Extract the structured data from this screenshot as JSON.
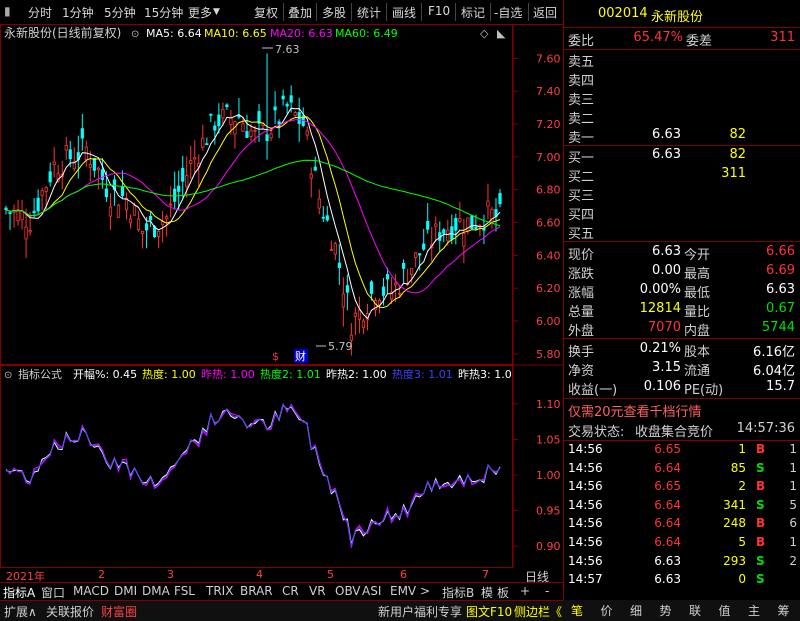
{
  "toolbar": {
    "left_items": [
      "分时",
      "1分钟",
      "5分钟",
      "15分钟",
      "更多"
    ],
    "right_items": [
      "复权",
      "叠加",
      "多股",
      "统计",
      "画线",
      "F10",
      "标记",
      "-自选",
      "返回"
    ]
  },
  "main_chart": {
    "stock_label": "永新股份(日线前复权)",
    "ma5": "MA5: 6.64",
    "ma10": "MA10: 6.65",
    "ma20": "MA20: 6.63",
    "ma60": "MA60: 6.49",
    "high_mark": "7.63",
    "low_mark": "5.79",
    "marker_s": "$",
    "marker_cai": "财"
  },
  "indicator": {
    "name": "指标公式",
    "kaifu": "开幅%: 0.45",
    "redu": "热度: 1.00",
    "zuore": "昨热: 1.00",
    "redu2": "热度2: 1.01",
    "zuore2": "昨热2: 1.00",
    "redu3": "热度3: 1.01",
    "zuore3": "昨热3: 1.0"
  },
  "colors": {
    "ma5": "#ffffff",
    "ma10": "#ffff00",
    "ma20": "#ff00ff",
    "ma60": "#00ff00",
    "up": "#ff3333",
    "down": "#00ffff",
    "frame": "#800000"
  },
  "chart_data": {
    "type": "candlestick",
    "y_axis": [
      "7.60",
      "7.40",
      "7.20",
      "7.00",
      "6.80",
      "6.60",
      "6.40",
      "6.20",
      "6.00",
      "5.80"
    ],
    "ylim": [
      5.75,
      7.7
    ],
    "indicator_axis": [
      "1.10",
      "1.05",
      "1.00",
      "0.95",
      "0.90"
    ],
    "indicator_ylim": [
      0.875,
      1.125
    ],
    "x_labels": [
      "2021年",
      "2",
      "3",
      "4",
      "5",
      "6",
      "7"
    ],
    "x_label_right": "日线"
  },
  "tabs": [
    "指标A",
    "窗口",
    "MACD",
    "DMI",
    "DMA",
    "FSL",
    "TRIX",
    "BRAR",
    "CR",
    "VR",
    "OBV",
    "ASI",
    "EMV",
    ">",
    "指标B",
    "模",
    "板",
    "+",
    "-"
  ],
  "status": {
    "left": [
      "扩展∧",
      "关联报价",
      "财富圈"
    ],
    "right": [
      "新用户福利专享",
      "图文F10",
      "侧边栏《"
    ]
  },
  "panel": {
    "code": "002014",
    "name": "永新股份",
    "weibi_label": "委比",
    "weibi_value": "65.47%",
    "weicha_label": "委差",
    "weicha_value": "311",
    "asks": [
      {
        "label": "卖五",
        "price": "",
        "vol": ""
      },
      {
        "label": "卖四",
        "price": "",
        "vol": ""
      },
      {
        "label": "卖三",
        "price": "",
        "vol": ""
      },
      {
        "label": "卖二",
        "price": "",
        "vol": ""
      },
      {
        "label": "卖一",
        "price": "6.63",
        "vol": "82"
      }
    ],
    "bids": [
      {
        "label": "买一",
        "price": "6.63",
        "vol": "82"
      },
      {
        "label": "买二",
        "price": "",
        "vol": "311"
      },
      {
        "label": "买三",
        "price": "",
        "vol": ""
      },
      {
        "label": "买四",
        "price": "",
        "vol": ""
      },
      {
        "label": "买五",
        "price": "",
        "vol": ""
      }
    ],
    "quote": [
      {
        "l1": "现价",
        "v1": "6.63",
        "c1": "white",
        "l2": "今开",
        "v2": "6.66",
        "c2": "red"
      },
      {
        "l1": "涨跌",
        "v1": "0.00",
        "c1": "white",
        "l2": "最高",
        "v2": "6.69",
        "c2": "red"
      },
      {
        "l1": "涨幅",
        "v1": "0.00%",
        "c1": "white",
        "l2": "最低",
        "v2": "6.63",
        "c2": "white"
      },
      {
        "l1": "总量",
        "v1": "12814",
        "c1": "yellow",
        "l2": "量比",
        "v2": "0.67",
        "c2": "green"
      },
      {
        "l1": "外盘",
        "v1": "7070",
        "c1": "red",
        "l2": "内盘",
        "v2": "5744",
        "c2": "green"
      }
    ],
    "finance": [
      {
        "l1": "换手",
        "v1": "0.21%",
        "l2": "股本",
        "v2": "6.16亿"
      },
      {
        "l1": "净资",
        "v1": "3.15",
        "l2": "流通",
        "v2": "6.04亿"
      },
      {
        "l1": "收益(一)",
        "v1": "0.106",
        "l2": "PE(动)",
        "v2": "15.7"
      }
    ],
    "promo": "仅需20元查看千档行情",
    "trade_state_label": "交易状态:",
    "trade_state": "收盘集合竞价",
    "trade_time": "14:57:36",
    "ticks": [
      {
        "t": "14:56",
        "p": "6.65",
        "pc": "red",
        "v": "1",
        "bs": "B",
        "bc": "red",
        "n": "1"
      },
      {
        "t": "14:56",
        "p": "6.64",
        "pc": "red",
        "v": "85",
        "bs": "S",
        "bc": "green",
        "n": "1"
      },
      {
        "t": "14:56",
        "p": "6.65",
        "pc": "red",
        "v": "2",
        "bs": "B",
        "bc": "red",
        "n": "1"
      },
      {
        "t": "14:56",
        "p": "6.64",
        "pc": "red",
        "v": "341",
        "bs": "S",
        "bc": "green",
        "n": "5"
      },
      {
        "t": "14:56",
        "p": "6.64",
        "pc": "red",
        "v": "248",
        "bs": "B",
        "bc": "red",
        "n": "6"
      },
      {
        "t": "14:56",
        "p": "6.64",
        "pc": "red",
        "v": "5",
        "bs": "B",
        "bc": "red",
        "n": "1"
      },
      {
        "t": "14:56",
        "p": "6.63",
        "pc": "white",
        "v": "293",
        "bs": "S",
        "bc": "green",
        "n": "2"
      },
      {
        "t": "14:57",
        "p": "6.63",
        "pc": "white",
        "v": "0",
        "bs": "S",
        "bc": "green",
        "n": ""
      }
    ],
    "nav": [
      "笔",
      "价",
      "细",
      "势",
      "联",
      "值",
      "主",
      "筹"
    ]
  }
}
